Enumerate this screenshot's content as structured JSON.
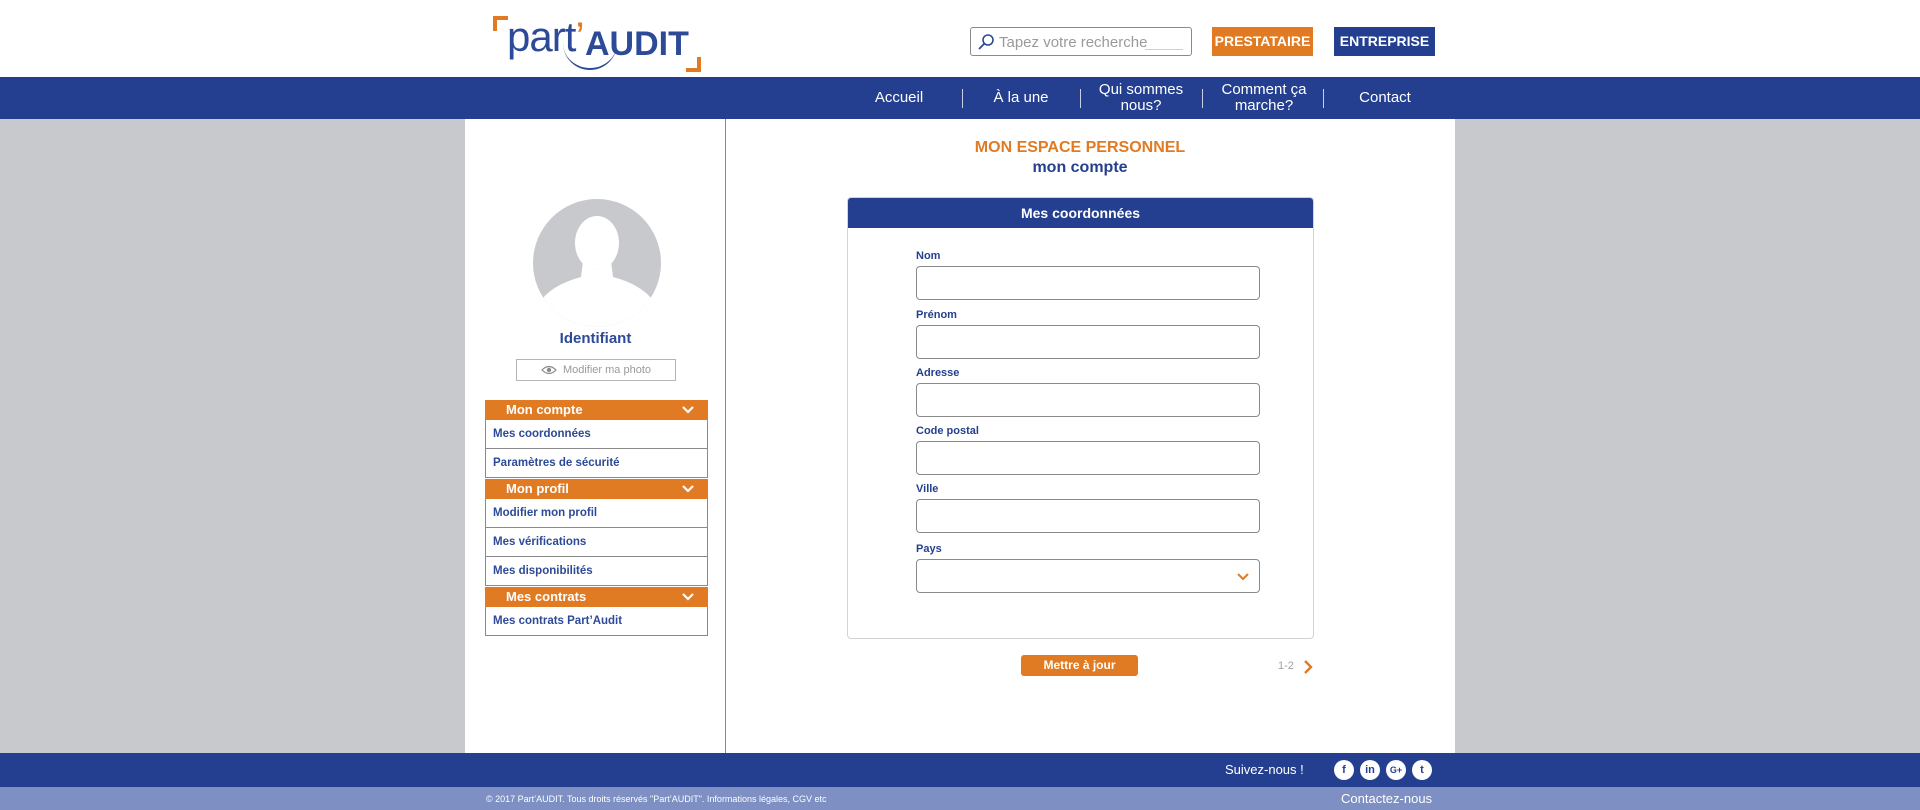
{
  "header": {
    "logo": {
      "part": "part",
      "apostrophe": "’",
      "audit": "AUDIT"
    },
    "search": {
      "placeholder": "Tapez votre recherche"
    },
    "buttons": {
      "prestataire": "PRESTATAIRE",
      "entreprise": "ENTREPRISE"
    }
  },
  "nav": {
    "items": [
      {
        "label": "Accueil"
      },
      {
        "label": "À la une"
      },
      {
        "label": "Qui sommes nous?"
      },
      {
        "label": "Comment ça marche?"
      },
      {
        "label": "Contact"
      }
    ]
  },
  "sidebar": {
    "identifiant": "Identifiant",
    "modify_photo": "Modifier ma photo",
    "sections": [
      {
        "title": "Mon compte",
        "items": [
          "Mes coordonnées",
          "Paramètres de sécurité"
        ]
      },
      {
        "title": "Mon profil",
        "items": [
          "Modifier mon profil",
          "Mes vérifications",
          "Mes disponibilités"
        ]
      },
      {
        "title": "Mes contrats",
        "items": [
          "Mes contrats Part’Audit"
        ]
      }
    ]
  },
  "main": {
    "title": "MON ESPACE PERSONNEL",
    "subtitle": "mon compte",
    "card_title": "Mes coordonnées",
    "fields": {
      "nom": {
        "label": "Nom",
        "value": ""
      },
      "prenom": {
        "label": "Prénom",
        "value": ""
      },
      "adresse": {
        "label": "Adresse",
        "value": ""
      },
      "code_postal": {
        "label": "Code postal",
        "value": ""
      },
      "ville": {
        "label": "Ville",
        "value": ""
      },
      "pays": {
        "label": "Pays",
        "value": ""
      }
    },
    "update_button": "Mettre à jour",
    "pagination": "1-2"
  },
  "footer": {
    "follow": "Suivez-nous !",
    "social": [
      "f",
      "in",
      "G+",
      "t"
    ],
    "copyright": "© 2017 Part’AUDIT. Tous droits réservés \"Part’AUDIT\". Informations légales, CGV etc",
    "contact": "Contactez-nous"
  },
  "colors": {
    "orange": "#e07b24",
    "blue": "#243f8f",
    "footer_light": "#7d8fc3",
    "background": "#c8c9cd"
  }
}
